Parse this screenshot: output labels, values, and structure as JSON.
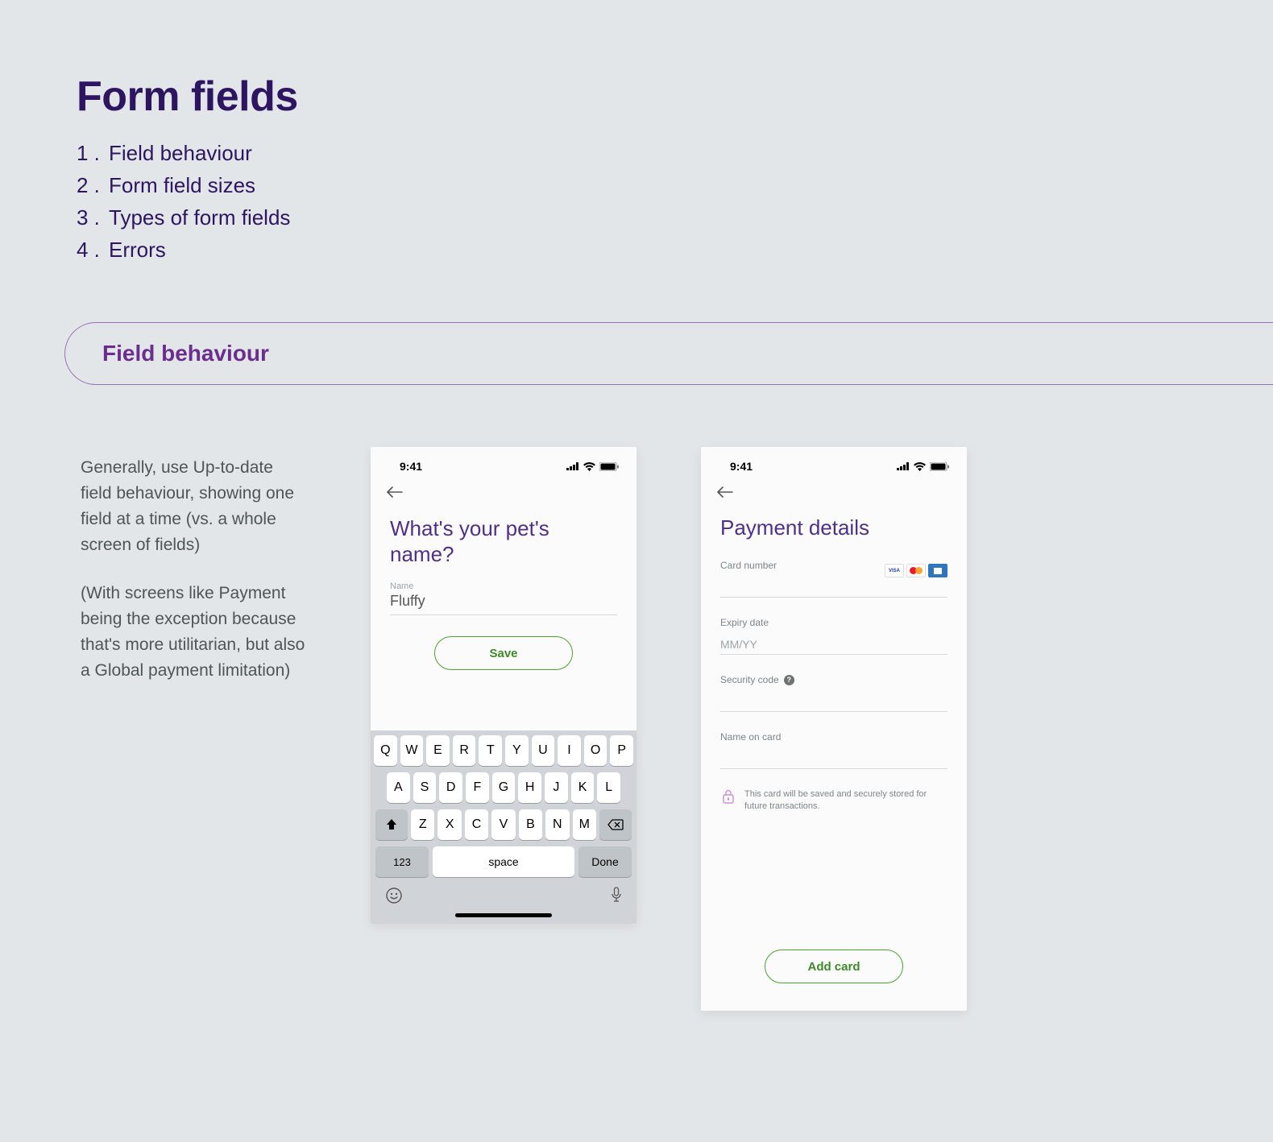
{
  "title": "Form fields",
  "toc": {
    "items": [
      {
        "num": "1 .",
        "label": "Field behaviour"
      },
      {
        "num": "2 .",
        "label": "Form field sizes"
      },
      {
        "num": "3 .",
        "label": "Types of form fields"
      },
      {
        "num": "4 .",
        "label": "Errors"
      }
    ]
  },
  "section_heading": "Field behaviour",
  "body": {
    "p1": "Generally, use Up-to-date field behaviour, showing one field at a time (vs. a whole screen of fields)",
    "p2": "(With screens like Payment being the exception because that's more utilitarian, but also a Global payment limitation)"
  },
  "status": {
    "time": "9:41"
  },
  "pet_screen": {
    "headline": "What's your pet's name?",
    "field_label": "Name",
    "field_value": "Fluffy",
    "save_label": "Save"
  },
  "keyboard": {
    "row1": [
      "Q",
      "W",
      "E",
      "R",
      "T",
      "Y",
      "U",
      "I",
      "O",
      "P"
    ],
    "row2": [
      "A",
      "S",
      "D",
      "F",
      "G",
      "H",
      "J",
      "K",
      "L"
    ],
    "row3": [
      "Z",
      "X",
      "C",
      "V",
      "B",
      "N",
      "M"
    ],
    "num_label": "123",
    "space_label": "space",
    "done_label": "Done"
  },
  "pay_screen": {
    "headline": "Payment details",
    "card_number_label": "Card number",
    "expiry_label": "Expiry date",
    "expiry_placeholder": "MM/YY",
    "security_label": "Security code",
    "name_label": "Name on card",
    "lock_text": "This card will be saved and securely stored for future transactions.",
    "add_label": "Add card",
    "card_brands": {
      "visa": "VISA"
    }
  }
}
